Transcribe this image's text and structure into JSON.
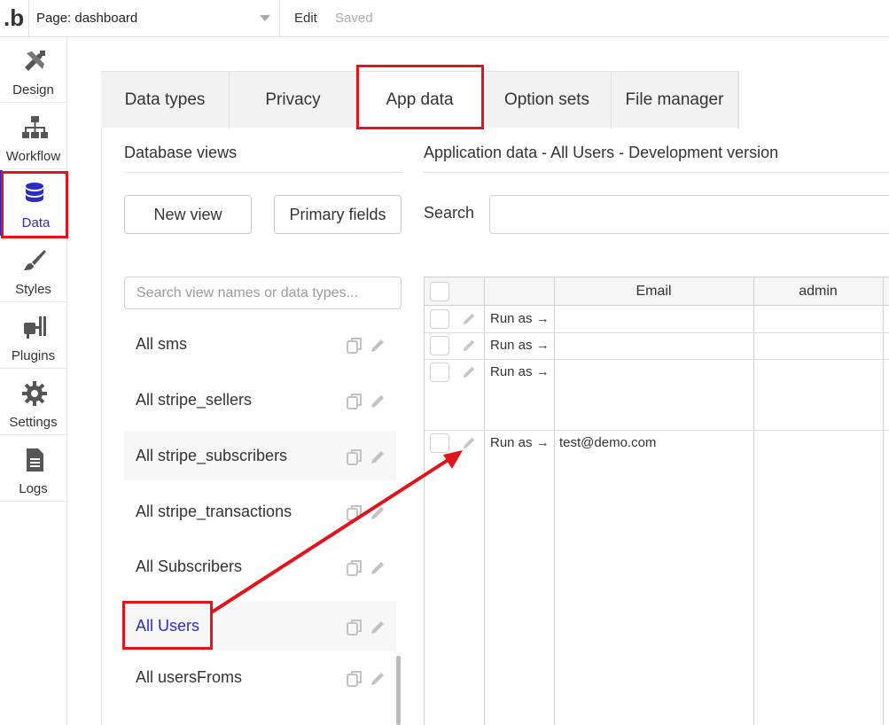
{
  "topbar": {
    "logo": ".b",
    "page_label": "Page: dashboard",
    "edit": "Edit",
    "saved": "Saved"
  },
  "sidebar": {
    "items": [
      {
        "label": "Design",
        "icon": "design-icon"
      },
      {
        "label": "Workflow",
        "icon": "workflow-icon"
      },
      {
        "label": "Data",
        "icon": "database-icon"
      },
      {
        "label": "Styles",
        "icon": "brush-icon"
      },
      {
        "label": "Plugins",
        "icon": "plug-icon"
      },
      {
        "label": "Settings",
        "icon": "gear-icon"
      },
      {
        "label": "Logs",
        "icon": "document-icon"
      }
    ],
    "active_color": "#2b2bc8"
  },
  "tabs": [
    {
      "label": "Data types"
    },
    {
      "label": "Privacy"
    },
    {
      "label": "App data"
    },
    {
      "label": "Option sets"
    },
    {
      "label": "File manager"
    }
  ],
  "db_views": {
    "title": "Database views",
    "new_view_label": "New view",
    "primary_fields_label": "Primary fields",
    "search_placeholder": "Search view names or data types...",
    "items": [
      {
        "label": "All sms"
      },
      {
        "label": "All stripe_sellers"
      },
      {
        "label": "All stripe_subscribers"
      },
      {
        "label": "All stripe_transactions"
      },
      {
        "label": "All Subscribers"
      },
      {
        "label": "All Users"
      },
      {
        "label": "All usersFroms"
      }
    ]
  },
  "app_data": {
    "title": "Application data - All Users - Development version",
    "search_label": "Search",
    "columns": [
      "",
      "",
      "Email",
      "admin"
    ],
    "rows": [
      {
        "run_as": "Run as →",
        "email": ""
      },
      {
        "run_as": "Run as →",
        "email": ""
      },
      {
        "run_as": "Run as →",
        "email": ""
      },
      {
        "run_as": "Run as →",
        "email": "test@demo.com"
      }
    ]
  },
  "colors": {
    "highlight": "#e3131b",
    "selected_text": "#2b2bc8"
  }
}
